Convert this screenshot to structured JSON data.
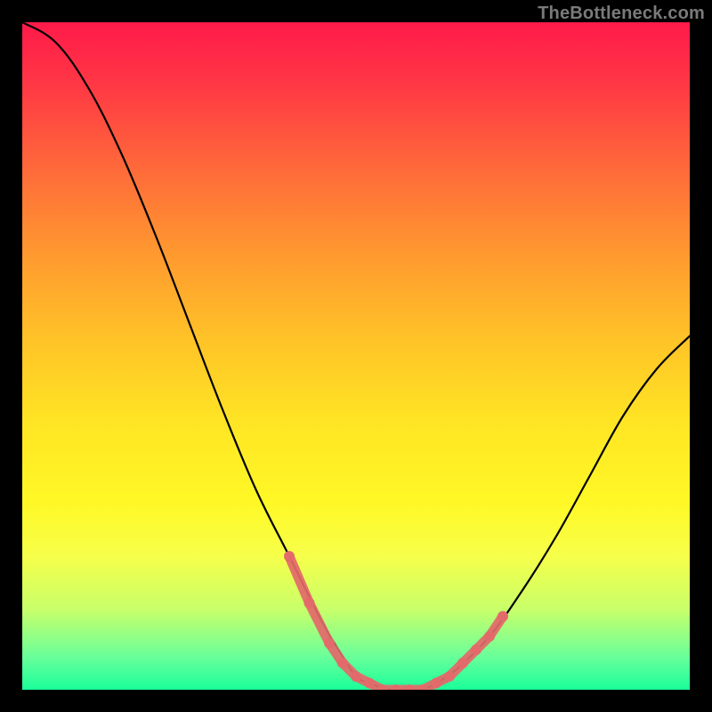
{
  "watermark": "TheBottleneck.com",
  "chart_data": {
    "type": "line",
    "title": "",
    "xlabel": "",
    "ylabel": "",
    "xlim": [
      0,
      100
    ],
    "ylim": [
      0,
      100
    ],
    "series": [
      {
        "name": "bottleneck-curve",
        "x": [
          0,
          5,
          10,
          15,
          20,
          25,
          30,
          35,
          40,
          45,
          48,
          50,
          52,
          55,
          58,
          60,
          62,
          65,
          70,
          75,
          80,
          85,
          90,
          95,
          100
        ],
        "y": [
          100,
          97,
          90,
          80,
          68,
          55,
          42,
          30,
          20,
          10,
          5,
          2,
          1,
          0,
          0,
          0,
          1,
          3,
          8,
          15,
          23,
          32,
          41,
          48,
          53
        ]
      }
    ],
    "markers": {
      "name": "valley-highlight",
      "color": "#e36a6a",
      "x": [
        40,
        43,
        46,
        48,
        50,
        52,
        54,
        56,
        58,
        60,
        62,
        64,
        66,
        68,
        70,
        72
      ],
      "y": [
        20,
        13,
        7,
        4,
        2,
        1,
        0,
        0,
        0,
        0,
        1,
        2,
        4,
        6,
        8,
        11
      ]
    },
    "gradient_direction": "vertical",
    "gradient_stops": [
      {
        "pos": 0.0,
        "color": "#ff1a4a"
      },
      {
        "pos": 0.1,
        "color": "#ff3a44"
      },
      {
        "pos": 0.22,
        "color": "#ff6a3a"
      },
      {
        "pos": 0.35,
        "color": "#ff9a2f"
      },
      {
        "pos": 0.48,
        "color": "#ffc427"
      },
      {
        "pos": 0.6,
        "color": "#ffe524"
      },
      {
        "pos": 0.72,
        "color": "#fff826"
      },
      {
        "pos": 0.8,
        "color": "#f6ff4a"
      },
      {
        "pos": 0.88,
        "color": "#c8ff6a"
      },
      {
        "pos": 0.95,
        "color": "#6aff9a"
      },
      {
        "pos": 1.0,
        "color": "#1aff9a"
      }
    ]
  }
}
